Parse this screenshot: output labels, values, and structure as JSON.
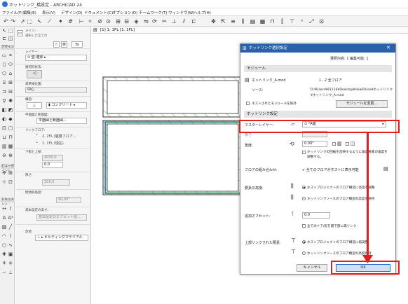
{
  "window": {
    "title": "ホットリンク_橋設定 - ARCHICAD 24"
  },
  "menu": [
    "ファイル(F)",
    "編集(E)",
    "表示(V)",
    "デザイン(D)",
    "ドキュメント(C)",
    "オプション(O)",
    "チームワーク(T)",
    "ウィンドウ(W)",
    "ヘルプ(H)"
  ],
  "canvas": {
    "tab_label": "[1] 1. 1FL [1. 1FL]"
  },
  "toolbox": {
    "groups": [
      "デザイン",
      "ビューポイント",
      "ドキュメント"
    ]
  },
  "infobox": {
    "header": "メイン:",
    "subheader": "選択した全ての",
    "layer_label": "レイヤー:",
    "layer_value": "壁-躯体",
    "geometry_label": "幾何形状法:",
    "ref_label": "基準線位置:",
    "ref_value": "中心",
    "structure_label": "構造:",
    "structure_value": "コンクリート",
    "floor_plan_label": "平面図と断面図:",
    "floor_plan_value": "平面図と断面図...",
    "link_label": "リンクフロア:",
    "top_link": "2. 2FL (躯層フロア...",
    "home_story": "1. 1FL (現在)",
    "bottom_label": "下部と上部:",
    "top_offset": "4000.0",
    "bottom_offset": "0.0",
    "thickness_label": "厚さ:",
    "thickness_value": "200.0",
    "angle_label": "壁傾斜角度:",
    "angle_value": "90.00°",
    "edge_label": "基本設定の実寸:",
    "edge_value": "基本設定のオフセット値...",
    "renovation_label": "改修:",
    "renovation_value": "ビルディングマテリアル"
  },
  "dialog": {
    "title": "ホットリンク選択設定",
    "selected_info": "選択内容: 1 編集可能: 1",
    "module_section": "モジュール",
    "module_name": "ホットリンク_A.mod",
    "module_floors": "1...2 全フロア",
    "source_label": "ソース:",
    "source_path_1": "D:¥Users¥91116¥Desktop¥HowToUse¥ホットリンク",
    "source_path_2": "¥ホットリンク_A.mod",
    "nested_label": "ネストされたモジュールを除外",
    "change_module_button": "モジュールを変更...",
    "settings_section": "ホットリンク設定",
    "master_layer_label": "マスターレイヤー:",
    "master_layer_value": "*A面",
    "elevation_label": "高さ:",
    "angle_label": "角度:",
    "angle_value": "0.00°",
    "mirror_label": "ホットリンクの回転を反映するように角度要素の角度を調整する。",
    "floor_combo_label": "フロアの組み合わせ:",
    "floor_combo_value": "全てのフロアがホストに表示可能",
    "element_height_label": "要素の高度:",
    "height_opt_1": "ホストプロジェクトのフロア構造に高度を調整",
    "height_opt_2": "ホットリンクソースのフロア構造の高度を保持",
    "extra_offset_label": "追加オフセット:",
    "extra_offset_value": "0.0",
    "skip_door_label": "全てのドア/窓を最下部に再リンク",
    "top_linked_label": "上部リンクされた要素:",
    "top_opt_1": "ホストプロジェクトのフロア構造に再調整",
    "top_opt_2": "ホットリンクソースのフロア構造の高度保持",
    "cancel_button": "キャンセル",
    "ok_button": "OK"
  },
  "colors": {
    "accent_red": "#e11e1e",
    "dialog_title_blue": "#2a62a8",
    "wall_green": "#38a838",
    "ok_blue": "#2b6cc4"
  }
}
